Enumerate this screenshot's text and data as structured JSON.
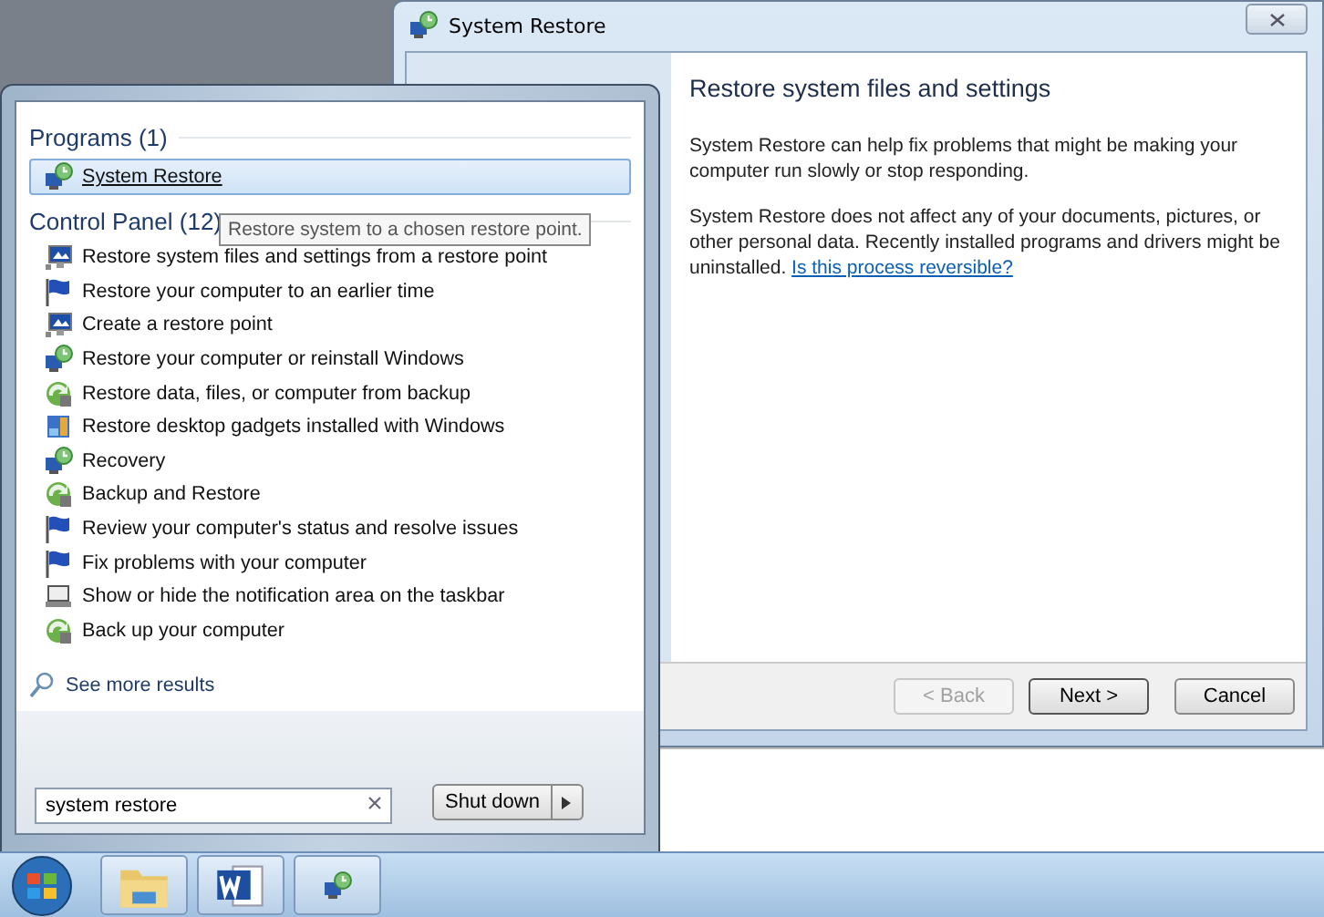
{
  "dialog": {
    "title": "System Restore",
    "heading": "Restore system files and settings",
    "paragraphs": [
      "System Restore can help fix problems that might be making your computer run slowly or stop responding.",
      "System Restore does not affect any of your documents, pictures, or other personal data. Recently installed programs and drivers might be uninstalled."
    ],
    "link": "Is this process reversible?",
    "buttons": [
      {
        "label": "< Back",
        "disabled": true,
        "default": false
      },
      {
        "label": "Next >",
        "disabled": false,
        "default": true
      },
      {
        "label": "Cancel",
        "disabled": false,
        "default": false
      }
    ]
  },
  "start_menu": {
    "sections": [
      {
        "title": "Programs (1)",
        "items": [
          {
            "label": "System Restore",
            "kind": "restore",
            "selected": true
          }
        ]
      },
      {
        "title": "Control Panel (12)",
        "items": [
          {
            "label": "Restore system files and settings from a restore point",
            "kind": "monitor",
            "selected": false
          },
          {
            "label": "Restore your computer to an earlier time",
            "kind": "flag",
            "selected": false
          },
          {
            "label": "Create a restore point",
            "kind": "monitor",
            "selected": false
          },
          {
            "label": "Restore your computer or reinstall Windows",
            "kind": "restore",
            "selected": false
          },
          {
            "label": "Restore data, files, or computer from backup",
            "kind": "backup",
            "selected": false
          },
          {
            "label": "Restore desktop gadgets installed with Windows",
            "kind": "gadget",
            "selected": false
          },
          {
            "label": "Recovery",
            "kind": "restore",
            "selected": false
          },
          {
            "label": "Backup and Restore",
            "kind": "backup",
            "selected": false
          },
          {
            "label": "Review your computer's status and resolve issues",
            "kind": "flag",
            "selected": false
          },
          {
            "label": "Fix problems with your computer",
            "kind": "flag",
            "selected": false
          },
          {
            "label": "Show or hide the notification area on the taskbar",
            "kind": "laptop",
            "selected": false
          },
          {
            "label": "Back up your computer",
            "kind": "backup",
            "selected": false
          }
        ]
      }
    ],
    "tooltip": "Restore system to a chosen restore point.",
    "more_results": "See more results",
    "search": {
      "value": "system restore"
    },
    "shutdown": "Shut down"
  },
  "taskbar": {
    "buttons": [
      {
        "kind": "folder"
      },
      {
        "kind": "word"
      },
      {
        "kind": "restore"
      }
    ]
  }
}
